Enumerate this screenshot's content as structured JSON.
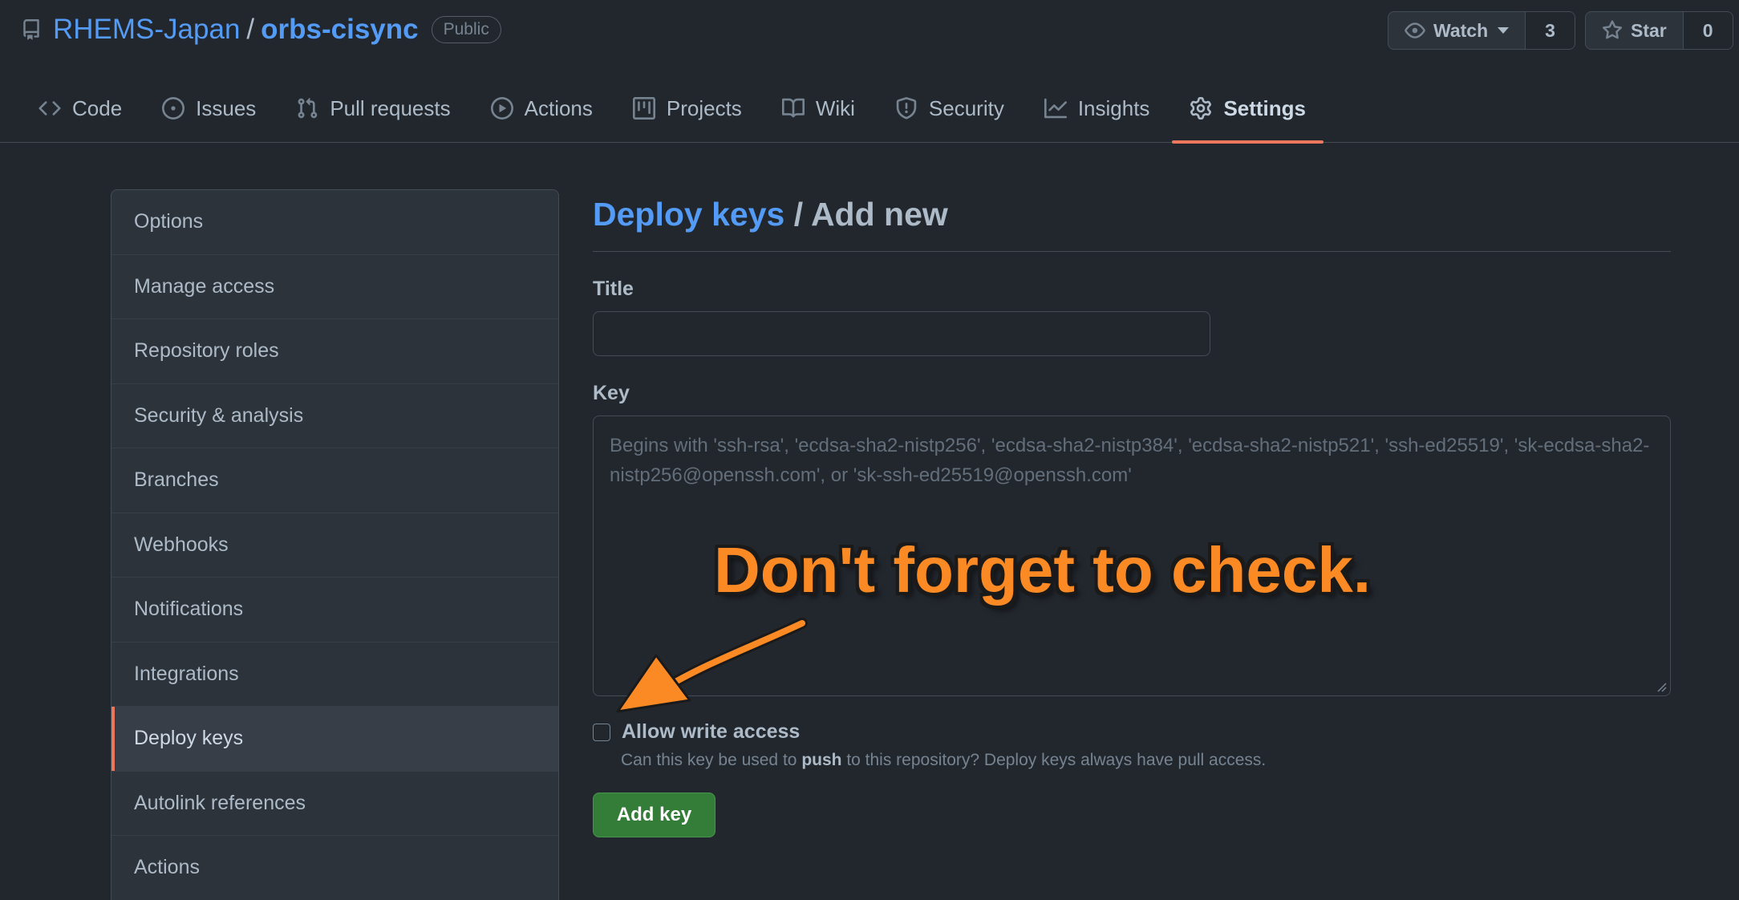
{
  "repo": {
    "owner": "RHEMS-Japan",
    "separator": "/",
    "name": "orbs-cisync",
    "visibility": "Public"
  },
  "actions": {
    "watch_label": "Watch",
    "watch_count": "3",
    "star_label": "Star",
    "star_count": "0"
  },
  "tabs": [
    {
      "label": "Code",
      "icon": "code-icon"
    },
    {
      "label": "Issues",
      "icon": "issue-icon"
    },
    {
      "label": "Pull requests",
      "icon": "pull-request-icon"
    },
    {
      "label": "Actions",
      "icon": "play-icon"
    },
    {
      "label": "Projects",
      "icon": "project-icon"
    },
    {
      "label": "Wiki",
      "icon": "book-icon"
    },
    {
      "label": "Security",
      "icon": "shield-icon"
    },
    {
      "label": "Insights",
      "icon": "graph-icon"
    },
    {
      "label": "Settings",
      "icon": "gear-icon",
      "active": true
    }
  ],
  "sidebar": {
    "items": [
      {
        "label": "Options"
      },
      {
        "label": "Manage access"
      },
      {
        "label": "Repository roles"
      },
      {
        "label": "Security & analysis"
      },
      {
        "label": "Branches"
      },
      {
        "label": "Webhooks"
      },
      {
        "label": "Notifications"
      },
      {
        "label": "Integrations"
      },
      {
        "label": "Deploy keys",
        "selected": true
      },
      {
        "label": "Autolink references"
      },
      {
        "label": "Actions"
      }
    ]
  },
  "form": {
    "heading_link": "Deploy keys",
    "heading_rest": " / Add new",
    "title_label": "Title",
    "title_value": "",
    "key_label": "Key",
    "key_placeholder": "Begins with 'ssh-rsa', 'ecdsa-sha2-nistp256', 'ecdsa-sha2-nistp384', 'ecdsa-sha2-nistp521', 'ssh-ed25519', 'sk-ecdsa-sha2-nistp256@openssh.com', or 'sk-ssh-ed25519@openssh.com'",
    "write_access_label": "Allow write access",
    "write_access_checked": false,
    "note_before": "Can this key be used to ",
    "note_bold": "push",
    "note_after": " to this repository? Deploy keys always have pull access.",
    "submit_label": "Add key"
  },
  "annotation": {
    "text": "Don't forget to check.",
    "color": "#fb8a24"
  },
  "colors": {
    "background": "#22272e",
    "accent_tab": "#ec775c",
    "link": "#539bf5",
    "button_green": "#347d39"
  }
}
